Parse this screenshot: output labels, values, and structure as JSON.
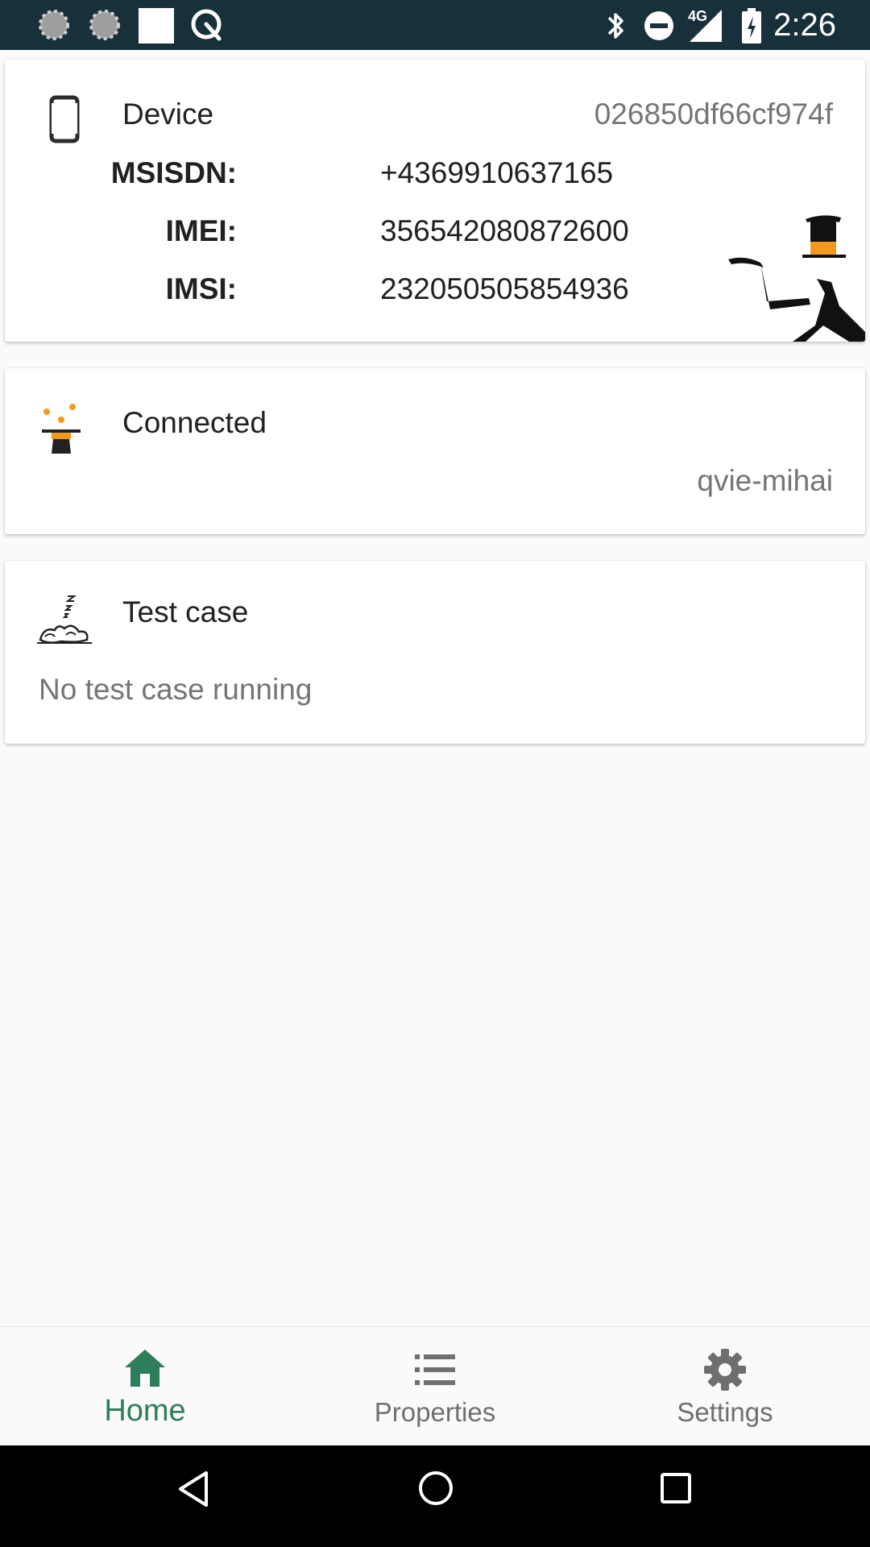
{
  "status_bar": {
    "time": "2:26",
    "network_label": "4G",
    "icons": [
      "loading-icon",
      "loading-icon",
      "white-square-icon",
      "search-sync-icon",
      "bluetooth-icon",
      "do-not-disturb-icon",
      "signal-icon",
      "battery-charging-icon"
    ]
  },
  "device_card": {
    "title": "Device",
    "device_id": "026850df66cf974f",
    "icon": "phone-icon",
    "rows": [
      {
        "label": "MSISDN:",
        "value": "+4369910637165"
      },
      {
        "label": "IMEI:",
        "value": "356542080872600"
      },
      {
        "label": "IMSI:",
        "value": "232050505854936"
      }
    ]
  },
  "connection_card": {
    "title": "Connected",
    "host": "qvie-mihai",
    "icon": "magic-hat-icon"
  },
  "testcase_card": {
    "title": "Test case",
    "status": "No test case running",
    "icon": "sleeping-rabbit-icon"
  },
  "bottom_nav": {
    "items": [
      {
        "label": "Home",
        "icon": "home-icon",
        "active": true
      },
      {
        "label": "Properties",
        "icon": "list-icon",
        "active": false
      },
      {
        "label": "Settings",
        "icon": "gear-icon",
        "active": false
      }
    ]
  },
  "colors": {
    "status_bar_bg": "#17303a",
    "accent_green": "#2e7d5b",
    "orange": "#f39a1e",
    "nav_bar_bg": "#000000"
  }
}
